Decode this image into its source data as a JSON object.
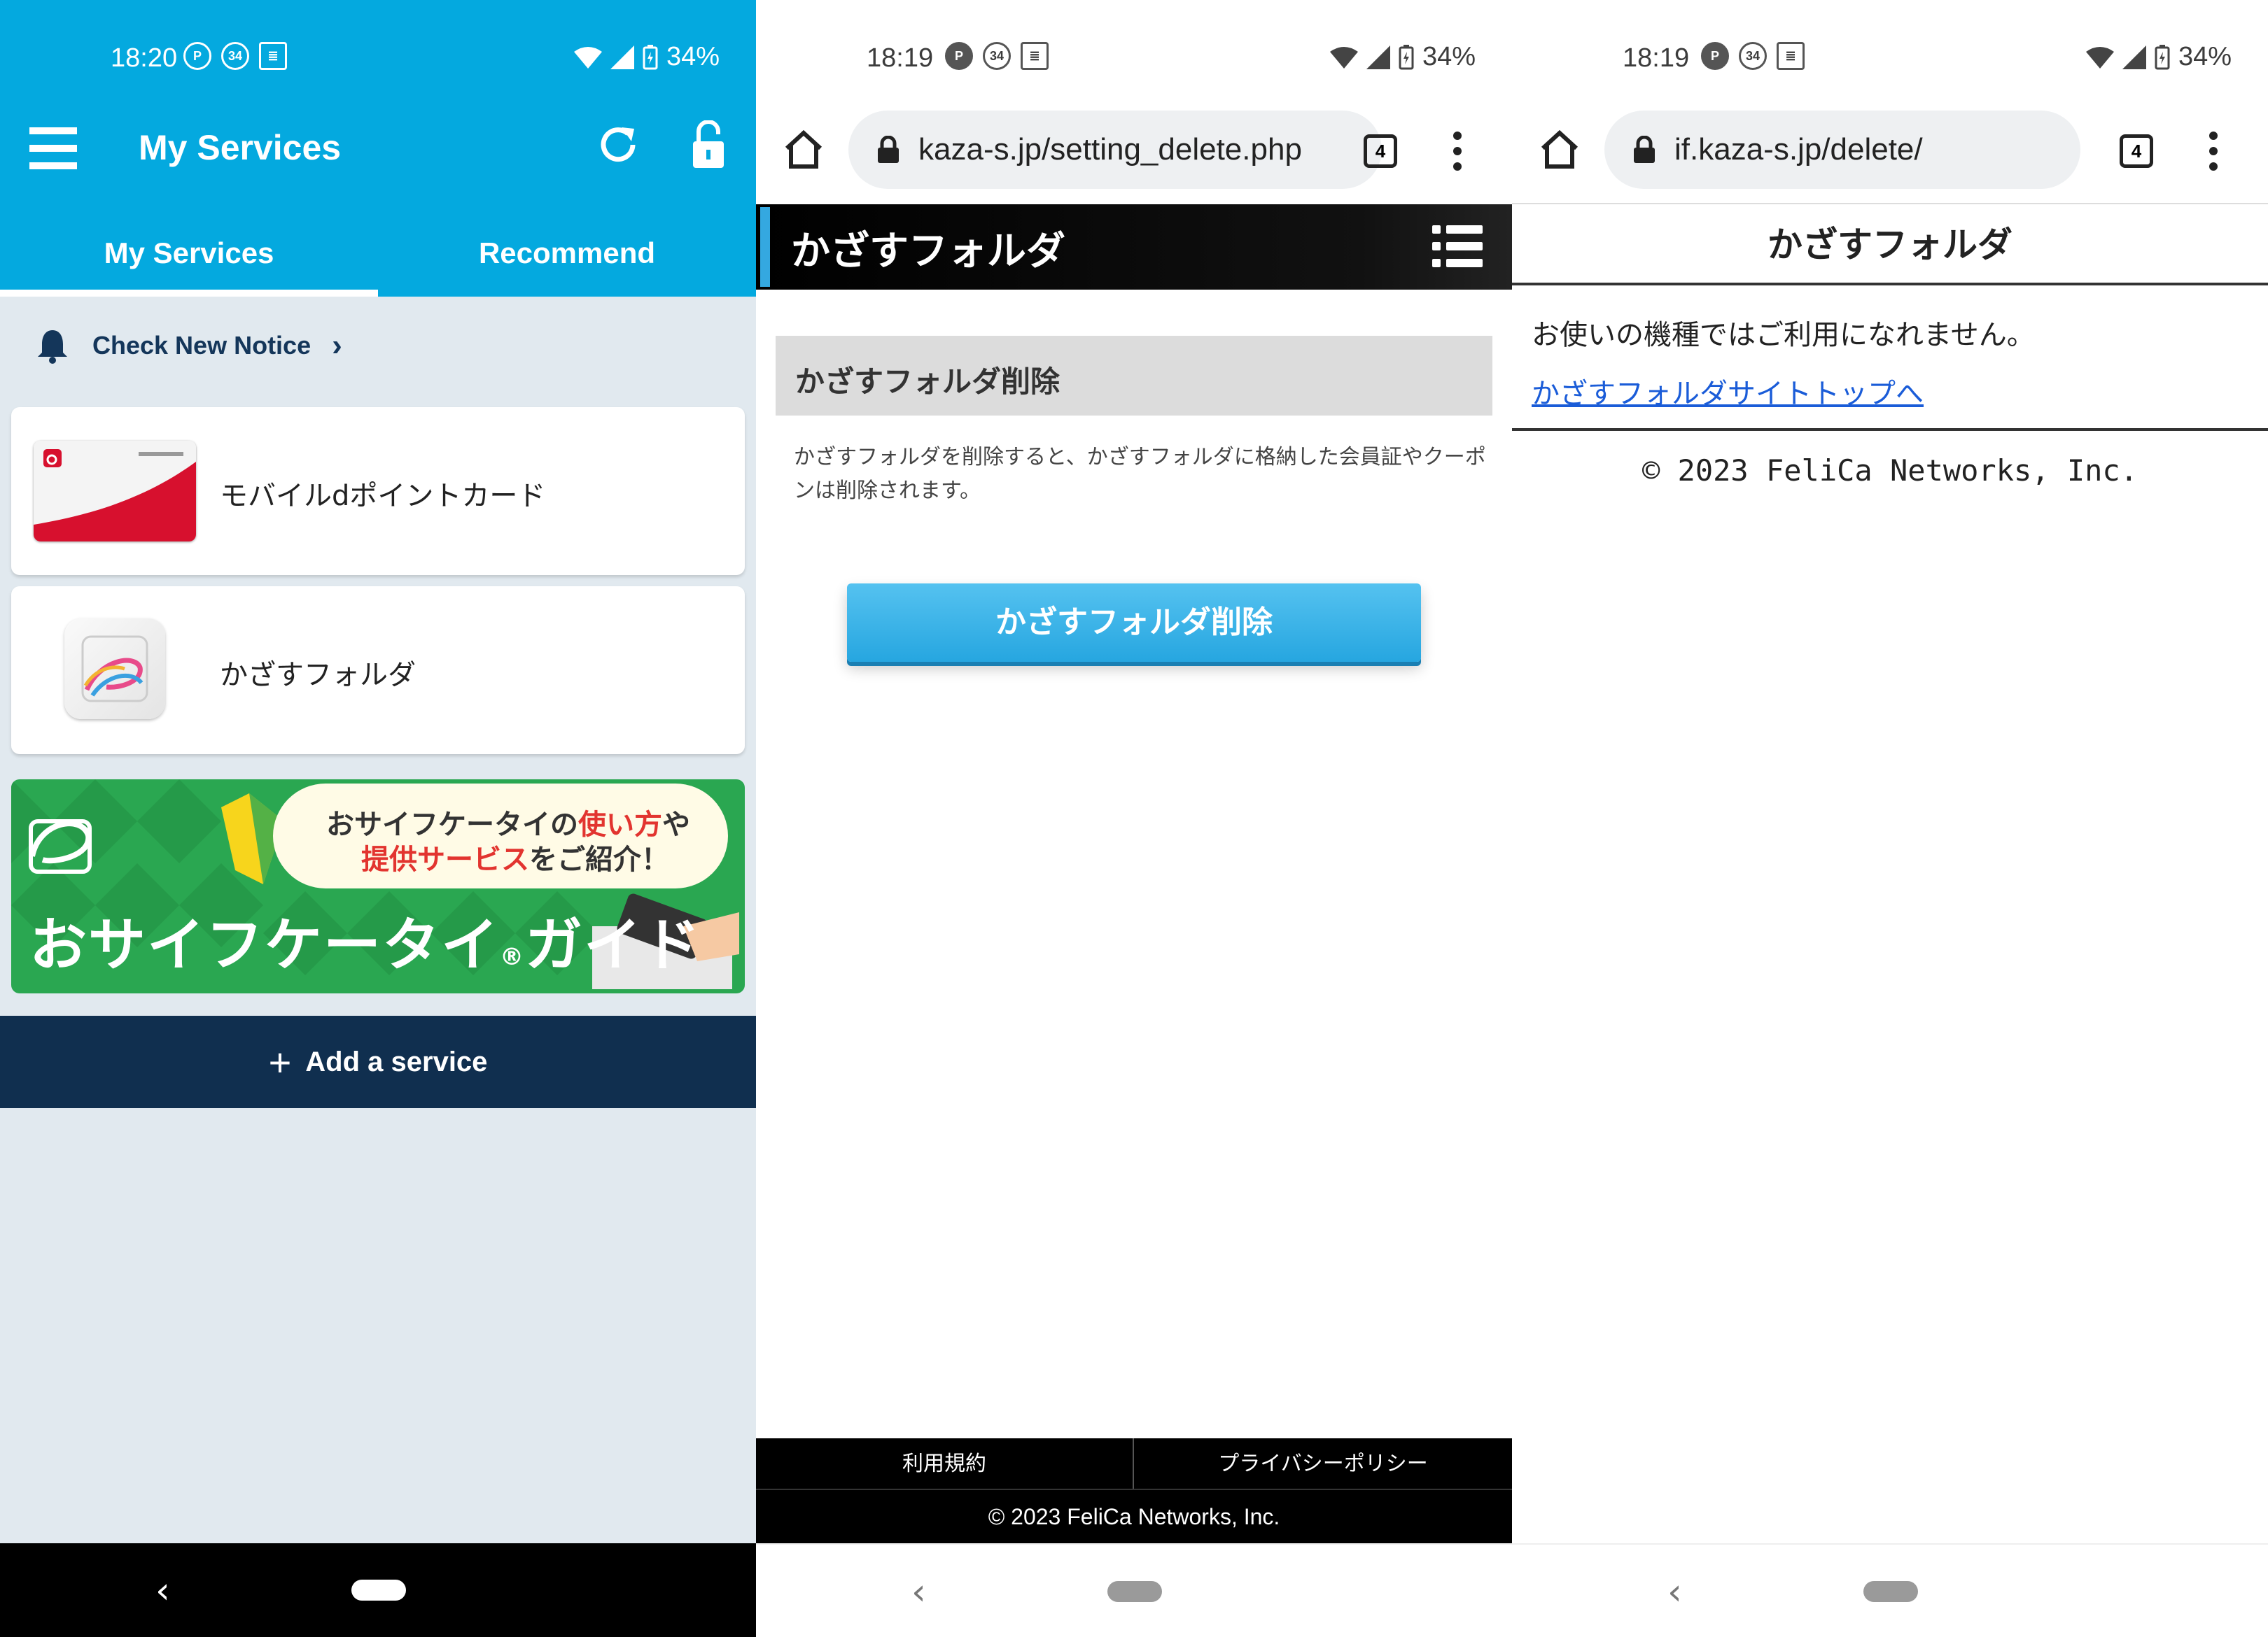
{
  "panel1": {
    "status": {
      "time": "18:20",
      "icon_badge": "34",
      "battery": "34%"
    },
    "app_title": "My Services",
    "tabs": [
      "My Services",
      "Recommend"
    ],
    "notice_label": "Check New Notice",
    "services": [
      {
        "name": "モバイルdポイントカード",
        "icon": "dpoint-card-icon"
      },
      {
        "name": "かざすフォルダ",
        "icon": "kazasu-folder-icon"
      }
    ],
    "banner": {
      "line1_a": "おサイフケータイの",
      "line1_red": "使い方",
      "line1_b": "や",
      "line2_red": "提供サービス",
      "line2_b": "をご紹介！",
      "title": "おサイフケータイ",
      "reg": "®",
      "title2": "ガイド"
    },
    "add_service": "Add a service"
  },
  "panel2": {
    "status": {
      "time": "18:19",
      "icon_badge": "34",
      "battery": "34%"
    },
    "url": "kaza-s.jp/setting_delete.php",
    "tab_count": "4",
    "header_title": "かざすフォルダ",
    "section_title": "かざすフォルダ削除",
    "description": "かざすフォルダを削除すると、かざすフォルダに格納した会員証やクーポンは削除されます。",
    "delete_button": "かざすフォルダ削除",
    "footer_links": [
      "利用規約",
      "プライバシーポリシー"
    ],
    "copyright": "© 2023 FeliCa Networks, Inc."
  },
  "panel3": {
    "status": {
      "time": "18:19",
      "icon_badge": "34",
      "battery": "34%"
    },
    "url": "if.kaza-s.jp/delete/",
    "tab_count": "4",
    "title": "かざすフォルダ",
    "message": "お使いの機種ではご利用になれません。",
    "top_link": "かざすフォルダサイトトップへ",
    "copyright": "© 2023 FeliCa Networks, Inc."
  },
  "colors": {
    "app_blue": "#04a9df",
    "navy": "#102f4f",
    "button_blue": "#26a6e0",
    "link_blue": "#1a5cd8",
    "banner_green": "#2aa751"
  }
}
